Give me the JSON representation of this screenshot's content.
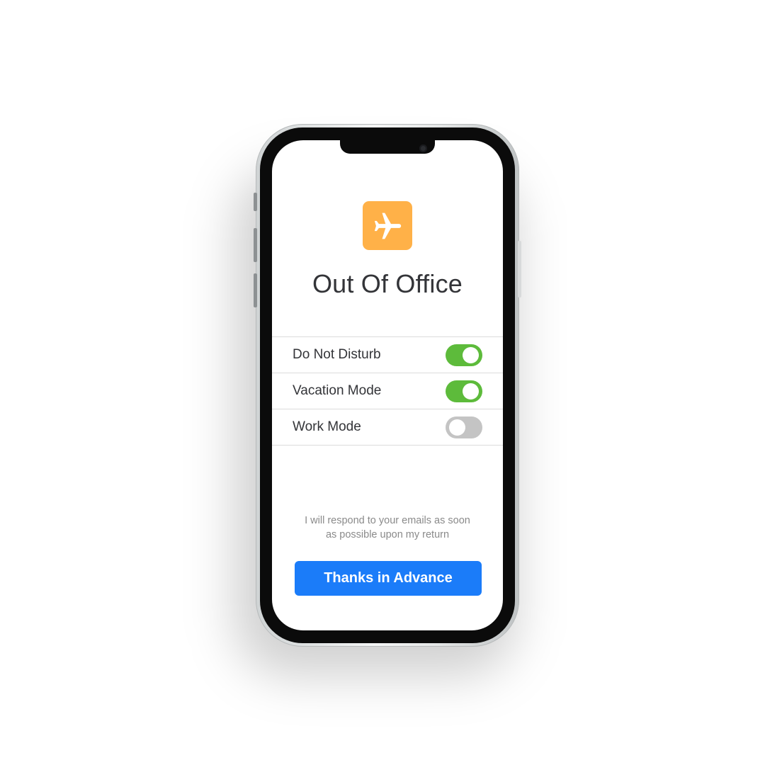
{
  "app": {
    "icon": "airplane-icon",
    "icon_color": "#ffb148",
    "title": "Out Of Office"
  },
  "settings": [
    {
      "label": "Do Not Disturb",
      "enabled": true
    },
    {
      "label": "Vacation Mode",
      "enabled": true
    },
    {
      "label": "Work Mode",
      "enabled": false
    }
  ],
  "message": {
    "line1": "I will respond to your emails as soon",
    "line2": "as possible upon my return"
  },
  "cta": {
    "label": "Thanks in Advance",
    "color": "#1b7cf9"
  },
  "colors": {
    "toggle_on": "#5dbb3b",
    "toggle_off": "#c4c4c4"
  }
}
